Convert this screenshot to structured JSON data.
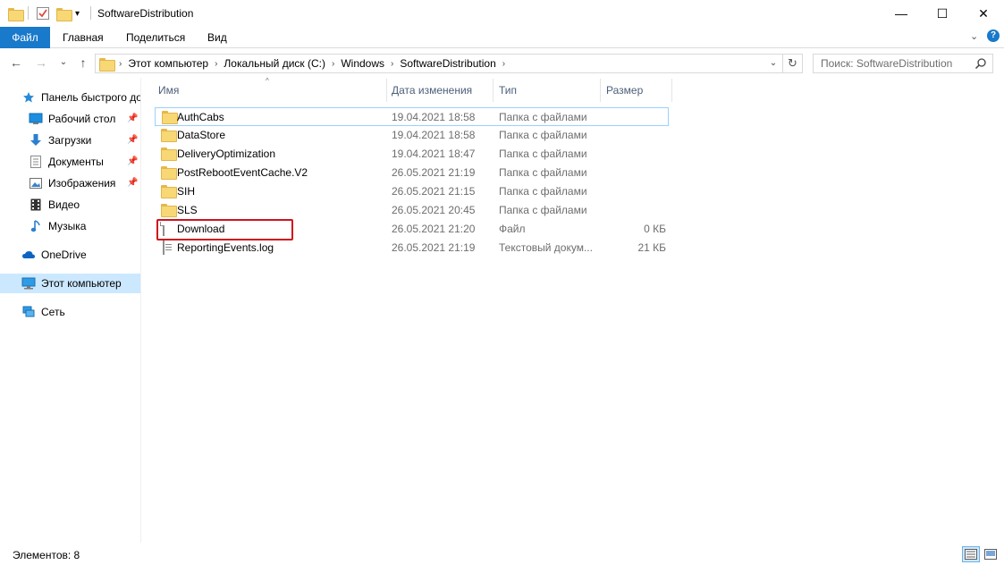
{
  "window": {
    "title": "SoftwareDistribution",
    "minimize": "—",
    "maximize": "☐",
    "close": "✕"
  },
  "ribbon": {
    "tabs": [
      {
        "label": "Файл"
      },
      {
        "label": "Главная"
      },
      {
        "label": "Поделиться"
      },
      {
        "label": "Вид"
      }
    ],
    "expand": "⌄",
    "help": "?"
  },
  "nav": {
    "back": "←",
    "forward": "→",
    "recent": "⌄",
    "up": "↑",
    "breadcrumb": [
      "Этот компьютер",
      "Локальный диск (C:)",
      "Windows",
      "SoftwareDistribution"
    ],
    "crumb_sep": "›",
    "address_dropdown": "⌄",
    "refresh": "↻",
    "search_placeholder": "Поиск: SoftwareDistribution"
  },
  "sidebar": {
    "items": [
      {
        "label": "Панель быстрого доступа",
        "icon": "star-icon",
        "pinned": false
      },
      {
        "label": "Рабочий стол",
        "icon": "desktop-icon",
        "pinned": true
      },
      {
        "label": "Загрузки",
        "icon": "download-arrow-icon",
        "pinned": true
      },
      {
        "label": "Документы",
        "icon": "documents-icon",
        "pinned": true
      },
      {
        "label": "Изображения",
        "icon": "pictures-icon",
        "pinned": true
      },
      {
        "label": "Видео",
        "icon": "video-icon",
        "pinned": false
      },
      {
        "label": "Музыка",
        "icon": "music-icon",
        "pinned": false
      },
      {
        "label": "OneDrive",
        "icon": "cloud-icon",
        "pinned": false
      },
      {
        "label": "Этот компьютер",
        "icon": "computer-icon",
        "pinned": false,
        "selected": true
      },
      {
        "label": "Сеть",
        "icon": "network-icon",
        "pinned": false
      }
    ],
    "pin_glyph": "📌"
  },
  "list": {
    "columns": {
      "name": "Имя",
      "date": "Дата изменения",
      "type": "Тип",
      "size": "Размер"
    },
    "sort_glyph": "^",
    "rows": [
      {
        "name": "AuthCabs",
        "date": "19.04.2021 18:58",
        "type": "Папка с файлами",
        "size": "",
        "icon": "folder-icon"
      },
      {
        "name": "DataStore",
        "date": "19.04.2021 18:58",
        "type": "Папка с файлами",
        "size": "",
        "icon": "folder-icon"
      },
      {
        "name": "DeliveryOptimization",
        "date": "19.04.2021 18:47",
        "type": "Папка с файлами",
        "size": "",
        "icon": "folder-icon"
      },
      {
        "name": "PostRebootEventCache.V2",
        "date": "26.05.2021 21:19",
        "type": "Папка с файлами",
        "size": "",
        "icon": "folder-icon"
      },
      {
        "name": "SIH",
        "date": "26.05.2021 21:15",
        "type": "Папка с файлами",
        "size": "",
        "icon": "folder-icon"
      },
      {
        "name": "SLS",
        "date": "26.05.2021 20:45",
        "type": "Папка с файлами",
        "size": "",
        "icon": "folder-icon"
      },
      {
        "name": "Download",
        "date": "26.05.2021 21:20",
        "type": "Файл",
        "size": "0 КБ",
        "icon": "file-icon"
      },
      {
        "name": "ReportingEvents.log",
        "date": "26.05.2021 21:19",
        "type": "Текстовый докум...",
        "size": "21 КБ",
        "icon": "text-file-icon"
      }
    ]
  },
  "status": {
    "items_count": "Элементов: 8"
  },
  "colors": {
    "accent": "#1979ca",
    "selection": "#cce8ff",
    "highlight_box": "#d0121b",
    "folder": "#f8d775"
  }
}
